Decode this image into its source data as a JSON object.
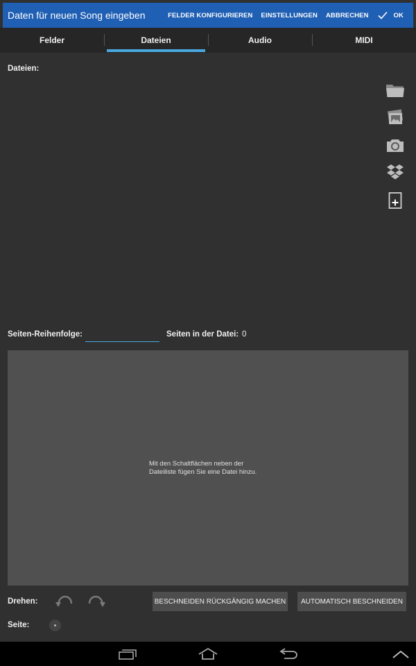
{
  "action_bar": {
    "title": "Daten für neuen Song eingeben",
    "configure_fields": "FELDER KONFIGURIEREN",
    "settings": "EINSTELLUNGEN",
    "cancel": "ABBRECHEN",
    "ok": "OK",
    "background_color": "#1f5fb4"
  },
  "tabs": [
    {
      "label": "Felder",
      "active": false
    },
    {
      "label": "Dateien",
      "active": true
    },
    {
      "label": "Audio",
      "active": false
    },
    {
      "label": "MIDI",
      "active": false
    }
  ],
  "files_section": {
    "label": "Dateien:",
    "side_icons": [
      "folder-icon",
      "gallery-icon",
      "camera-icon",
      "dropbox-icon",
      "new-document-icon"
    ]
  },
  "page_order": {
    "label": "Seiten-Reihenfolge:",
    "value": "",
    "pages_in_file_label": "Seiten in der Datei:",
    "pages_in_file_value": "0"
  },
  "preview": {
    "hint": "Mit den Schaltflächen neben der Dateiliste fügen Sie eine Datei hinzu."
  },
  "controls": {
    "rotate_label": "Drehen:",
    "undo_crop": "BESCHNEIDEN RÜCKGÄNGIG MACHEN",
    "auto_crop": "AUTOMATISCH BESCHNEIDEN",
    "page_label": "Seite:"
  },
  "accent_color": "#4aa8e0"
}
